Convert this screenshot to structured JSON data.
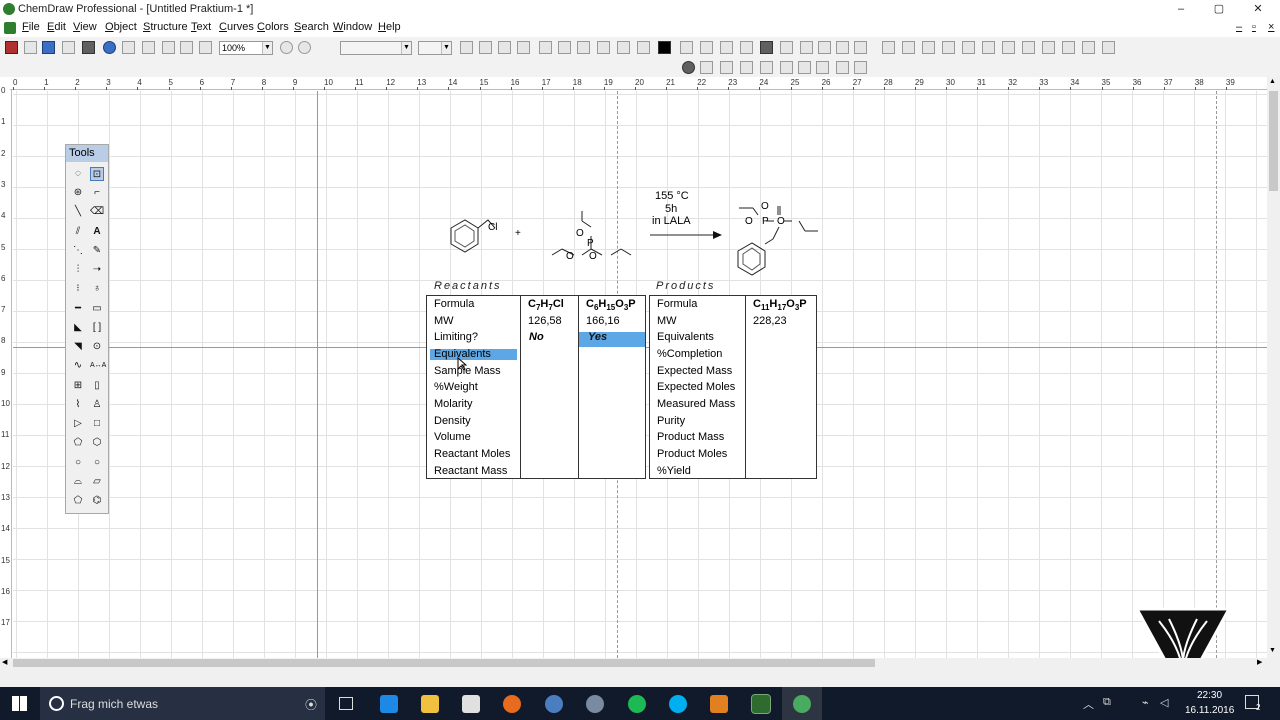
{
  "window": {
    "title": "ChemDraw Professional - [Untitled Praktium-1 *]",
    "min": "–",
    "max": "▢",
    "close": "✕"
  },
  "menu": [
    "File",
    "Edit",
    "View",
    "Object",
    "Structure",
    "Text",
    "Curves",
    "Colors",
    "Search",
    "Window",
    "Help"
  ],
  "toolbar": {
    "zoom": "100%"
  },
  "ruler": {
    "h": [
      "0",
      "1",
      "2",
      "3",
      "4",
      "5",
      "6",
      "7",
      "8",
      "9",
      "10",
      "11",
      "12",
      "13",
      "14",
      "15",
      "16",
      "17",
      "18",
      "19",
      "20",
      "21",
      "22",
      "23",
      "24",
      "25",
      "26",
      "27",
      "28",
      "29",
      "30",
      "31",
      "32",
      "33",
      "34",
      "35",
      "36",
      "37",
      "38",
      "39"
    ],
    "v": [
      "0",
      "1",
      "2",
      "3",
      "4",
      "5",
      "6",
      "7",
      "8",
      "9",
      "10",
      "11",
      "12",
      "13",
      "14",
      "15",
      "16",
      "17"
    ]
  },
  "tools": {
    "title": "Tools"
  },
  "reaction": {
    "cl": "Cl",
    "plus": "+",
    "cond1": "155 °C",
    "cond2": "5h",
    "cond3": "in LALA",
    "o_label": "O",
    "p_label": "P"
  },
  "reactants": {
    "header": "Reactants",
    "rows": [
      "Formula",
      "MW",
      "Limiting?",
      "Equivalents",
      "Sample Mass",
      "%Weight",
      "Molarity",
      "Density",
      "Volume",
      "Reactant Moles",
      "Reactant Mass"
    ],
    "c1": {
      "formula": "C7H7Cl",
      "mw": "126,58",
      "limiting": "No"
    },
    "c2": {
      "formula": "C6H15O3P",
      "mw": "166,16",
      "limiting": "Yes"
    }
  },
  "products": {
    "header": "Products",
    "rows": [
      "Formula",
      "MW",
      "Equivalents",
      "%Completion",
      "Expected Mass",
      "Expected Moles",
      "Measured Mass",
      "Purity",
      "Product Mass",
      "Product Moles",
      "%Yield"
    ],
    "c1": {
      "formula": "C11H17O3P",
      "mw": "228,23"
    }
  },
  "taskbar": {
    "search": "Frag mich etwas",
    "time": "22:30",
    "date": "16.11.2016",
    "notify": "2"
  },
  "colors": {
    "selection": "#5ea7e6",
    "taskbar": "#101a2a",
    "tools_header": "#b9cde6"
  }
}
